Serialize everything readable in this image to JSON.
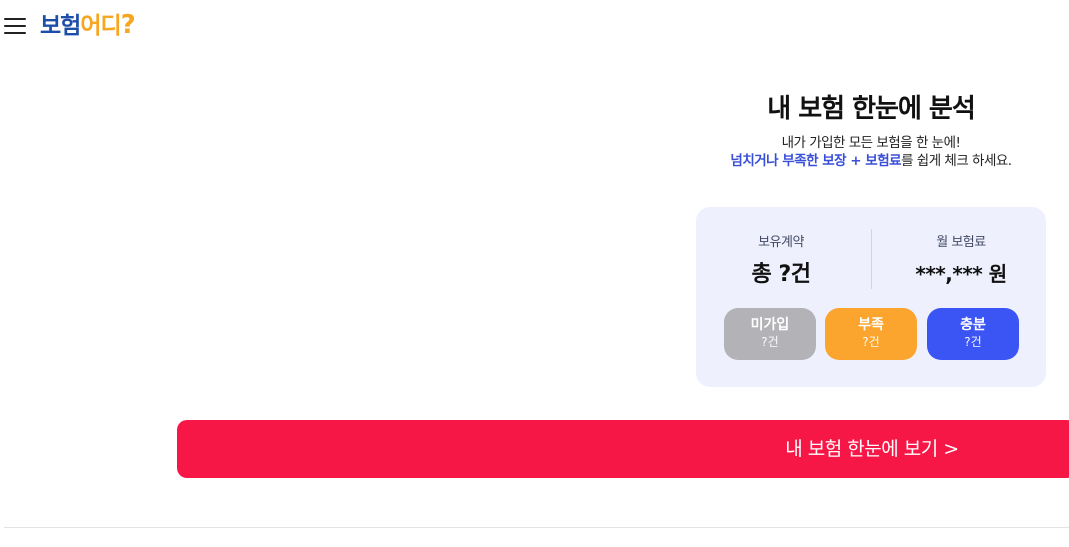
{
  "header": {
    "logo_part1": "보험",
    "logo_part2": "어디",
    "logo_part3": "?",
    "menu_icon": "hamburger-menu-icon"
  },
  "main": {
    "title": "내 보험 한눈에 분석",
    "subtitle_line1": "내가 가입한 모든 보험을 한 눈에!",
    "subtitle_highlight": "넘치거나 부족한 보장 + 보험료",
    "subtitle_rest": "를 쉽게 체크 하세요."
  },
  "summary": {
    "contracts_label": "보유계약",
    "contracts_value": "총 ?건",
    "premium_label": "월 보험료",
    "premium_value": "***,*** 원"
  },
  "status_pills": [
    {
      "name": "미가입",
      "count": "?건",
      "color": "#b2b2b7"
    },
    {
      "name": "부족",
      "count": "?건",
      "color": "#fba52f"
    },
    {
      "name": "충분",
      "count": "?건",
      "color": "#3b55f5"
    }
  ],
  "cta": {
    "label": "내 보험 한눈에 보기 >",
    "color": "#f71747"
  }
}
